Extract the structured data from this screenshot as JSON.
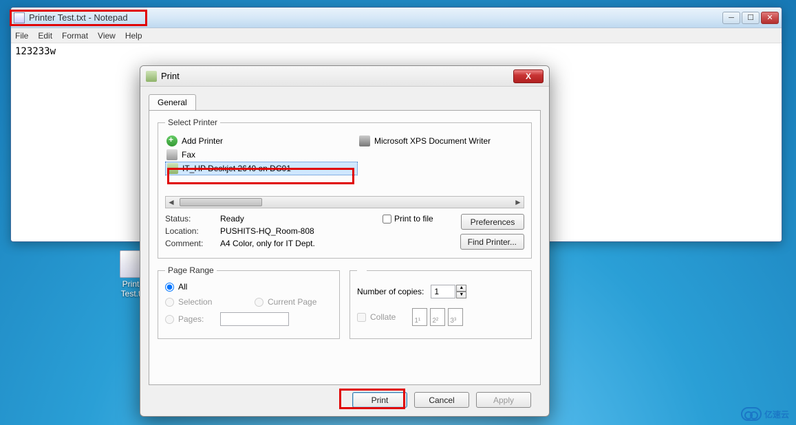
{
  "notepad": {
    "title": "Printer Test.txt - Notepad",
    "menu": {
      "file": "File",
      "edit": "Edit",
      "format": "Format",
      "view": "View",
      "help": "Help"
    },
    "content": "123233w"
  },
  "desktop": {
    "icon_label": "Print\nTest.t"
  },
  "print": {
    "title": "Print",
    "tab_general": "General",
    "select_printer_legend": "Select Printer",
    "printers": {
      "add": "Add Printer",
      "fax": "Fax",
      "selected": "IT_HP Deskjet 2640 on DC01",
      "xps": "Microsoft XPS Document Writer"
    },
    "status_label": "Status:",
    "status_value": "Ready",
    "location_label": "Location:",
    "location_value": "PUSHITS-HQ_Room-808",
    "comment_label": "Comment:",
    "comment_value": "A4 Color, only for IT Dept.",
    "print_to_file": "Print to file",
    "preferences": "Preferences",
    "find_printer": "Find Printer...",
    "page_range_legend": "Page Range",
    "radio_all": "All",
    "radio_selection": "Selection",
    "radio_current": "Current Page",
    "radio_pages": "Pages:",
    "copies_label": "Number of copies:",
    "copies_value": "1",
    "collate": "Collate",
    "collate_pages": [
      "1¹",
      "2²",
      "3³"
    ],
    "btn_print": "Print",
    "btn_cancel": "Cancel",
    "btn_apply": "Apply"
  },
  "watermark": "亿速云"
}
